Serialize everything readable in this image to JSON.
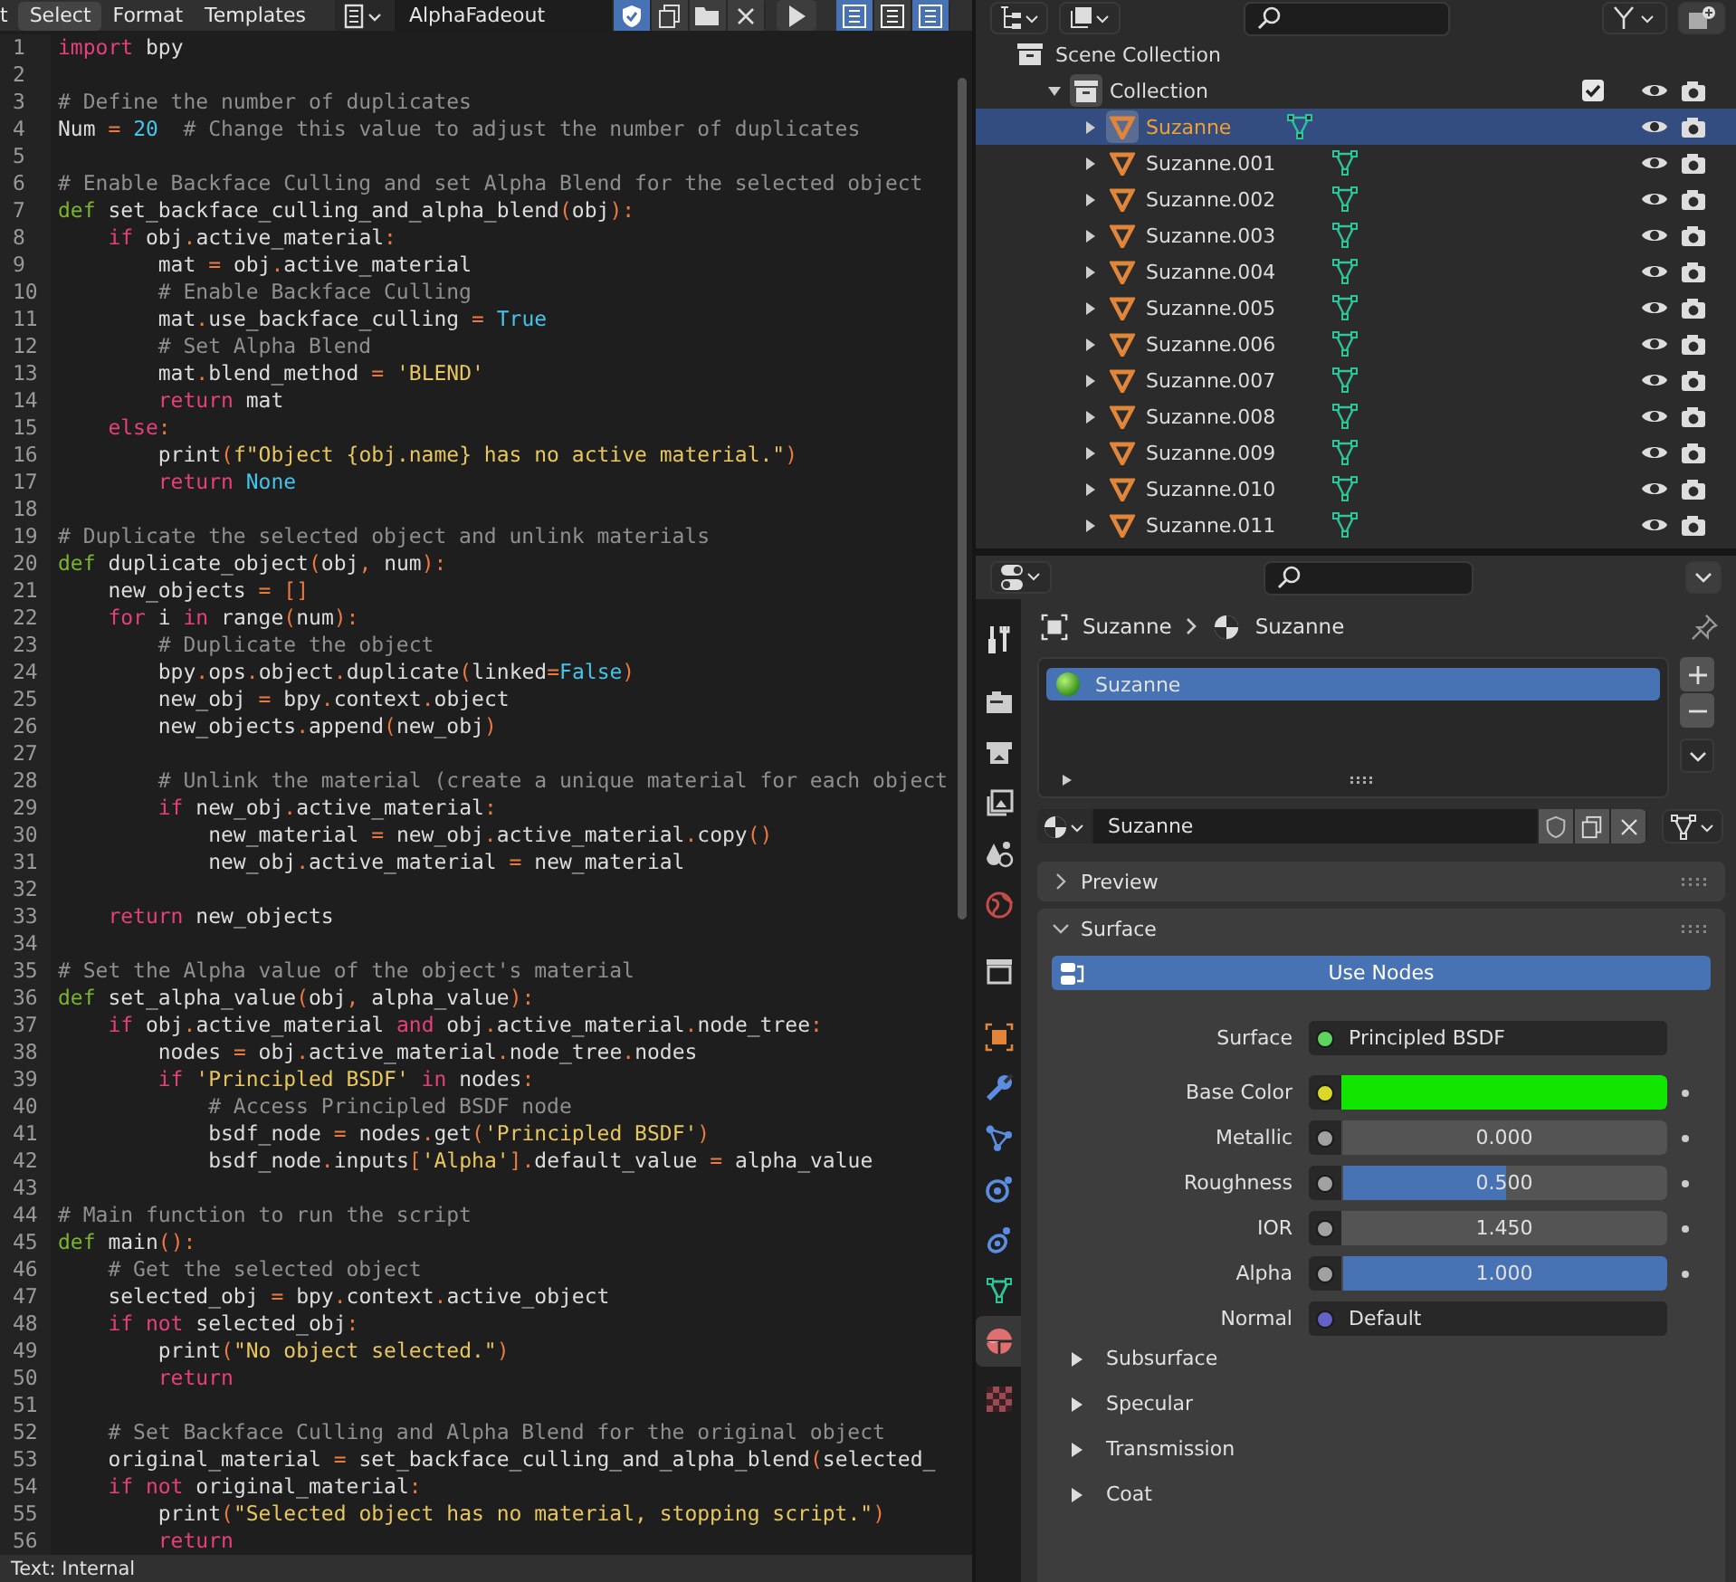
{
  "text_editor": {
    "menus": [
      {
        "label": "t",
        "selected": false
      },
      {
        "label": "Select",
        "selected": true
      },
      {
        "label": "Format",
        "selected": false
      },
      {
        "label": "Templates",
        "selected": false
      }
    ],
    "text_name": "AlphaFadeout",
    "fake_user": true,
    "toggles": [
      {
        "on": true
      },
      {
        "on": false
      },
      {
        "on": true
      }
    ],
    "lines": [
      {
        "n": "1",
        "segs": [
          {
            "kind": "keyword",
            "text": "import"
          },
          {
            "kind": "plain",
            "text": " bpy"
          }
        ]
      },
      {
        "n": "2"
      },
      {
        "n": "3",
        "segs": [
          {
            "kind": "comment",
            "text": "# Define the number of duplicates"
          }
        ]
      },
      {
        "n": "4",
        "segs": [
          {
            "kind": "plain",
            "text": "Num "
          },
          {
            "kind": "op",
            "text": "="
          },
          {
            "kind": "const",
            "text": " 20"
          },
          {
            "kind": "comment",
            "text": "  # Change this value to adjust the number of duplicates"
          }
        ]
      },
      {
        "n": "5"
      },
      {
        "n": "6",
        "segs": [
          {
            "kind": "comment",
            "text": "# Enable Backface Culling and set Alpha Blend for the selected object"
          }
        ]
      },
      {
        "n": "7",
        "segs": [
          {
            "kind": "def",
            "text": "def"
          },
          {
            "kind": "plain",
            "text": " set_backface_culling_and_alpha_blend"
          },
          {
            "kind": "op",
            "text": "("
          },
          {
            "kind": "plain",
            "text": "obj"
          },
          {
            "kind": "op",
            "text": "):"
          }
        ]
      },
      {
        "n": "8",
        "segs": [
          {
            "kind": "keyword",
            "text": "    if"
          },
          {
            "kind": "plain",
            "text": " obj"
          },
          {
            "kind": "op",
            "text": "."
          },
          {
            "kind": "plain",
            "text": "active_material"
          },
          {
            "kind": "op",
            "text": ":"
          }
        ]
      },
      {
        "n": "9",
        "segs": [
          {
            "kind": "plain",
            "text": "        mat "
          },
          {
            "kind": "op",
            "text": "="
          },
          {
            "kind": "plain",
            "text": " obj"
          },
          {
            "kind": "op",
            "text": "."
          },
          {
            "kind": "plain",
            "text": "active_material"
          }
        ]
      },
      {
        "n": "10",
        "segs": [
          {
            "kind": "comment",
            "text": "        # Enable Backface Culling"
          }
        ]
      },
      {
        "n": "11",
        "segs": [
          {
            "kind": "plain",
            "text": "        mat"
          },
          {
            "kind": "op",
            "text": "."
          },
          {
            "kind": "plain",
            "text": "use_backface_culling "
          },
          {
            "kind": "op",
            "text": "="
          },
          {
            "kind": "const",
            "text": " True"
          }
        ]
      },
      {
        "n": "12",
        "segs": [
          {
            "kind": "comment",
            "text": "        # Set Alpha Blend"
          }
        ]
      },
      {
        "n": "13",
        "segs": [
          {
            "kind": "plain",
            "text": "        mat"
          },
          {
            "kind": "op",
            "text": "."
          },
          {
            "kind": "plain",
            "text": "blend_method "
          },
          {
            "kind": "op",
            "text": "="
          },
          {
            "kind": "string",
            "text": " 'BLEND'"
          }
        ]
      },
      {
        "n": "14",
        "segs": [
          {
            "kind": "keyword",
            "text": "        return"
          },
          {
            "kind": "plain",
            "text": " mat"
          }
        ]
      },
      {
        "n": "15",
        "segs": [
          {
            "kind": "keyword",
            "text": "    else"
          },
          {
            "kind": "op",
            "text": ":"
          }
        ]
      },
      {
        "n": "16",
        "segs": [
          {
            "kind": "plain",
            "text": "        print"
          },
          {
            "kind": "op",
            "text": "("
          },
          {
            "kind": "string",
            "text": "f\"Object {obj.name} has no active material.\""
          },
          {
            "kind": "op",
            "text": ")"
          }
        ]
      },
      {
        "n": "17",
        "segs": [
          {
            "kind": "keyword",
            "text": "        return"
          },
          {
            "kind": "const",
            "text": " None"
          }
        ]
      },
      {
        "n": "18"
      },
      {
        "n": "19",
        "segs": [
          {
            "kind": "comment",
            "text": "# Duplicate the selected object and unlink materials"
          }
        ]
      },
      {
        "n": "20",
        "segs": [
          {
            "kind": "def",
            "text": "def"
          },
          {
            "kind": "plain",
            "text": " duplicate_object"
          },
          {
            "kind": "op",
            "text": "("
          },
          {
            "kind": "plain",
            "text": "obj"
          },
          {
            "kind": "op",
            "text": ","
          },
          {
            "kind": "plain",
            "text": " num"
          },
          {
            "kind": "op",
            "text": "):"
          }
        ]
      },
      {
        "n": "21",
        "segs": [
          {
            "kind": "plain",
            "text": "    new_objects "
          },
          {
            "kind": "op",
            "text": "="
          },
          {
            "kind": "op",
            "text": " []"
          }
        ]
      },
      {
        "n": "22",
        "segs": [
          {
            "kind": "keyword",
            "text": "    for"
          },
          {
            "kind": "plain",
            "text": " i "
          },
          {
            "kind": "keyword",
            "text": "in"
          },
          {
            "kind": "plain",
            "text": " range"
          },
          {
            "kind": "op",
            "text": "("
          },
          {
            "kind": "plain",
            "text": "num"
          },
          {
            "kind": "op",
            "text": "):"
          }
        ]
      },
      {
        "n": "23",
        "segs": [
          {
            "kind": "comment",
            "text": "        # Duplicate the object"
          }
        ]
      },
      {
        "n": "24",
        "segs": [
          {
            "kind": "plain",
            "text": "        bpy"
          },
          {
            "kind": "op",
            "text": "."
          },
          {
            "kind": "plain",
            "text": "ops"
          },
          {
            "kind": "op",
            "text": "."
          },
          {
            "kind": "plain",
            "text": "object"
          },
          {
            "kind": "op",
            "text": "."
          },
          {
            "kind": "plain",
            "text": "duplicate"
          },
          {
            "kind": "op",
            "text": "("
          },
          {
            "kind": "plain",
            "text": "linked"
          },
          {
            "kind": "op",
            "text": "="
          },
          {
            "kind": "const",
            "text": "False"
          },
          {
            "kind": "op",
            "text": ")"
          }
        ]
      },
      {
        "n": "25",
        "segs": [
          {
            "kind": "plain",
            "text": "        new_obj "
          },
          {
            "kind": "op",
            "text": "="
          },
          {
            "kind": "plain",
            "text": " bpy"
          },
          {
            "kind": "op",
            "text": "."
          },
          {
            "kind": "plain",
            "text": "context"
          },
          {
            "kind": "op",
            "text": "."
          },
          {
            "kind": "plain",
            "text": "object"
          }
        ]
      },
      {
        "n": "26",
        "segs": [
          {
            "kind": "plain",
            "text": "        new_objects"
          },
          {
            "kind": "op",
            "text": "."
          },
          {
            "kind": "plain",
            "text": "append"
          },
          {
            "kind": "op",
            "text": "("
          },
          {
            "kind": "plain",
            "text": "new_obj"
          },
          {
            "kind": "op",
            "text": ")"
          }
        ]
      },
      {
        "n": "27"
      },
      {
        "n": "28",
        "segs": [
          {
            "kind": "comment",
            "text": "        # Unlink the material (create a unique material for each object"
          }
        ]
      },
      {
        "n": "29",
        "segs": [
          {
            "kind": "keyword",
            "text": "        if"
          },
          {
            "kind": "plain",
            "text": " new_obj"
          },
          {
            "kind": "op",
            "text": "."
          },
          {
            "kind": "plain",
            "text": "active_material"
          },
          {
            "kind": "op",
            "text": ":"
          }
        ]
      },
      {
        "n": "30",
        "segs": [
          {
            "kind": "plain",
            "text": "            new_material "
          },
          {
            "kind": "op",
            "text": "="
          },
          {
            "kind": "plain",
            "text": " new_obj"
          },
          {
            "kind": "op",
            "text": "."
          },
          {
            "kind": "plain",
            "text": "active_material"
          },
          {
            "kind": "op",
            "text": "."
          },
          {
            "kind": "plain",
            "text": "copy"
          },
          {
            "kind": "op",
            "text": "()"
          }
        ]
      },
      {
        "n": "31",
        "segs": [
          {
            "kind": "plain",
            "text": "            new_obj"
          },
          {
            "kind": "op",
            "text": "."
          },
          {
            "kind": "plain",
            "text": "active_material "
          },
          {
            "kind": "op",
            "text": "="
          },
          {
            "kind": "plain",
            "text": " new_material"
          }
        ]
      },
      {
        "n": "32"
      },
      {
        "n": "33",
        "segs": [
          {
            "kind": "keyword",
            "text": "    return"
          },
          {
            "kind": "plain",
            "text": " new_objects"
          }
        ]
      },
      {
        "n": "34"
      },
      {
        "n": "35",
        "segs": [
          {
            "kind": "comment",
            "text": "# Set the Alpha value of the object's material"
          }
        ]
      },
      {
        "n": "36",
        "segs": [
          {
            "kind": "def",
            "text": "def"
          },
          {
            "kind": "plain",
            "text": " set_alpha_value"
          },
          {
            "kind": "op",
            "text": "("
          },
          {
            "kind": "plain",
            "text": "obj"
          },
          {
            "kind": "op",
            "text": ","
          },
          {
            "kind": "plain",
            "text": " alpha_value"
          },
          {
            "kind": "op",
            "text": "):"
          }
        ]
      },
      {
        "n": "37",
        "segs": [
          {
            "kind": "keyword",
            "text": "    if"
          },
          {
            "kind": "plain",
            "text": " obj"
          },
          {
            "kind": "op",
            "text": "."
          },
          {
            "kind": "plain",
            "text": "active_material "
          },
          {
            "kind": "keyword",
            "text": "and"
          },
          {
            "kind": "plain",
            "text": " obj"
          },
          {
            "kind": "op",
            "text": "."
          },
          {
            "kind": "plain",
            "text": "active_material"
          },
          {
            "kind": "op",
            "text": "."
          },
          {
            "kind": "plain",
            "text": "node_tree"
          },
          {
            "kind": "op",
            "text": ":"
          }
        ]
      },
      {
        "n": "38",
        "segs": [
          {
            "kind": "plain",
            "text": "        nodes "
          },
          {
            "kind": "op",
            "text": "="
          },
          {
            "kind": "plain",
            "text": " obj"
          },
          {
            "kind": "op",
            "text": "."
          },
          {
            "kind": "plain",
            "text": "active_material"
          },
          {
            "kind": "op",
            "text": "."
          },
          {
            "kind": "plain",
            "text": "node_tree"
          },
          {
            "kind": "op",
            "text": "."
          },
          {
            "kind": "plain",
            "text": "nodes"
          }
        ]
      },
      {
        "n": "39",
        "segs": [
          {
            "kind": "keyword",
            "text": "        if"
          },
          {
            "kind": "string",
            "text": " 'Principled BSDF'"
          },
          {
            "kind": "keyword",
            "text": " in"
          },
          {
            "kind": "plain",
            "text": " nodes"
          },
          {
            "kind": "op",
            "text": ":"
          }
        ]
      },
      {
        "n": "40",
        "segs": [
          {
            "kind": "comment",
            "text": "            # Access Principled BSDF node"
          }
        ]
      },
      {
        "n": "41",
        "segs": [
          {
            "kind": "plain",
            "text": "            bsdf_node "
          },
          {
            "kind": "op",
            "text": "="
          },
          {
            "kind": "plain",
            "text": " nodes"
          },
          {
            "kind": "op",
            "text": "."
          },
          {
            "kind": "plain",
            "text": "get"
          },
          {
            "kind": "op",
            "text": "("
          },
          {
            "kind": "string",
            "text": "'Principled BSDF'"
          },
          {
            "kind": "op",
            "text": ")"
          }
        ]
      },
      {
        "n": "42",
        "segs": [
          {
            "kind": "plain",
            "text": "            bsdf_node"
          },
          {
            "kind": "op",
            "text": "."
          },
          {
            "kind": "plain",
            "text": "inputs"
          },
          {
            "kind": "op",
            "text": "["
          },
          {
            "kind": "string",
            "text": "'Alpha'"
          },
          {
            "kind": "op",
            "text": "]."
          },
          {
            "kind": "plain",
            "text": "default_value "
          },
          {
            "kind": "op",
            "text": "="
          },
          {
            "kind": "plain",
            "text": " alpha_value"
          }
        ]
      },
      {
        "n": "43"
      },
      {
        "n": "44",
        "segs": [
          {
            "kind": "comment",
            "text": "# Main function to run the script"
          }
        ]
      },
      {
        "n": "45",
        "segs": [
          {
            "kind": "def",
            "text": "def"
          },
          {
            "kind": "plain",
            "text": " main"
          },
          {
            "kind": "op",
            "text": "():"
          }
        ]
      },
      {
        "n": "46",
        "segs": [
          {
            "kind": "comment",
            "text": "    # Get the selected object"
          }
        ]
      },
      {
        "n": "47",
        "segs": [
          {
            "kind": "plain",
            "text": "    selected_obj "
          },
          {
            "kind": "op",
            "text": "="
          },
          {
            "kind": "plain",
            "text": " bpy"
          },
          {
            "kind": "op",
            "text": "."
          },
          {
            "kind": "plain",
            "text": "context"
          },
          {
            "kind": "op",
            "text": "."
          },
          {
            "kind": "plain",
            "text": "active_object"
          }
        ]
      },
      {
        "n": "48",
        "segs": [
          {
            "kind": "keyword",
            "text": "    if not"
          },
          {
            "kind": "plain",
            "text": " selected_obj"
          },
          {
            "kind": "op",
            "text": ":"
          }
        ]
      },
      {
        "n": "49",
        "segs": [
          {
            "kind": "plain",
            "text": "        print"
          },
          {
            "kind": "op",
            "text": "("
          },
          {
            "kind": "string",
            "text": "\"No object selected.\""
          },
          {
            "kind": "op",
            "text": ")"
          }
        ]
      },
      {
        "n": "50",
        "segs": [
          {
            "kind": "keyword",
            "text": "        return"
          }
        ]
      },
      {
        "n": "51"
      },
      {
        "n": "52",
        "segs": [
          {
            "kind": "comment",
            "text": "    # Set Backface Culling and Alpha Blend for the original object"
          }
        ]
      },
      {
        "n": "53",
        "segs": [
          {
            "kind": "plain",
            "text": "    original_material "
          },
          {
            "kind": "op",
            "text": "="
          },
          {
            "kind": "plain",
            "text": " set_backface_culling_and_alpha_blend"
          },
          {
            "kind": "op",
            "text": "("
          },
          {
            "kind": "plain",
            "text": "selected_"
          }
        ]
      },
      {
        "n": "54",
        "segs": [
          {
            "kind": "keyword",
            "text": "    if not"
          },
          {
            "kind": "plain",
            "text": " original_material"
          },
          {
            "kind": "op",
            "text": ":"
          }
        ]
      },
      {
        "n": "55",
        "segs": [
          {
            "kind": "plain",
            "text": "        print"
          },
          {
            "kind": "op",
            "text": "("
          },
          {
            "kind": "string",
            "text": "\"Selected object has no material, stopping script.\""
          },
          {
            "kind": "op",
            "text": ")"
          }
        ]
      },
      {
        "n": "56",
        "segs": [
          {
            "kind": "keyword",
            "text": "        return"
          }
        ]
      }
    ],
    "status": "Text: Internal"
  },
  "outliner": {
    "tree": [
      {
        "kind": "scene",
        "label": "Scene Collection",
        "children": [
          {
            "kind": "collection",
            "label": "Collection",
            "expanded": true,
            "checked": true,
            "children": [
              {
                "kind": "object",
                "label": "Suzanne",
                "selected": true
              },
              {
                "kind": "object",
                "label": "Suzanne.001",
                "selected": false
              },
              {
                "kind": "object",
                "label": "Suzanne.002",
                "selected": false
              },
              {
                "kind": "object",
                "label": "Suzanne.003",
                "selected": false
              },
              {
                "kind": "object",
                "label": "Suzanne.004",
                "selected": false
              },
              {
                "kind": "object",
                "label": "Suzanne.005",
                "selected": false
              },
              {
                "kind": "object",
                "label": "Suzanne.006",
                "selected": false
              },
              {
                "kind": "object",
                "label": "Suzanne.007",
                "selected": false
              },
              {
                "kind": "object",
                "label": "Suzanne.008",
                "selected": false
              },
              {
                "kind": "object",
                "label": "Suzanne.009",
                "selected": false
              },
              {
                "kind": "object",
                "label": "Suzanne.010",
                "selected": false
              },
              {
                "kind": "object",
                "label": "Suzanne.011",
                "selected": false
              }
            ]
          }
        ]
      }
    ]
  },
  "properties": {
    "tabs": [
      {
        "selected": false
      },
      {
        "selected": false
      },
      {
        "selected": false
      },
      {
        "selected": false
      },
      {
        "selected": false
      },
      {
        "selected": false
      },
      {
        "selected": false
      },
      {
        "selected": false
      },
      {
        "selected": false
      },
      {
        "selected": false
      },
      {
        "selected": false
      },
      {
        "selected": false
      },
      {
        "selected": false
      },
      {
        "selected": true
      },
      {
        "selected": false
      }
    ],
    "breadcrumb": [
      "Suzanne",
      "Suzanne"
    ],
    "slots": [
      {
        "label": "Suzanne",
        "selected": true
      }
    ],
    "material_name": "Suzanne",
    "panels": [
      {
        "label": "Preview",
        "expanded": false
      },
      {
        "label": "Surface",
        "expanded": true
      }
    ],
    "use_nodes": "Use Nodes",
    "inputs": [
      {
        "kind": "link",
        "label": "Surface",
        "value": "Principled BSDF",
        "color": "#5fd35f"
      },
      {
        "kind": "swatch",
        "label": "Base Color",
        "swatch": {
          "color": "#10e600"
        },
        "color": "#d9d92a"
      },
      {
        "kind": "slider",
        "label": "Metallic",
        "value": "0.000",
        "level": 0,
        "color": "#a1a1a1"
      },
      {
        "kind": "slider",
        "label": "Roughness",
        "value": "0.500",
        "level": 0.5,
        "color": "#a1a1a1"
      },
      {
        "kind": "number",
        "label": "IOR",
        "value": "1.450",
        "color": "#a1a1a1"
      },
      {
        "kind": "slider",
        "label": "Alpha",
        "value": "1.000",
        "level": 1,
        "color": "#a1a1a1"
      },
      {
        "kind": "link",
        "label": "Normal",
        "value": "Default",
        "color": "#6363c7"
      }
    ],
    "subpanels": [
      {
        "label": "Subsurface",
        "expanded": false
      },
      {
        "label": "Specular",
        "expanded": false
      },
      {
        "label": "Transmission",
        "expanded": false
      },
      {
        "label": "Coat",
        "expanded": false
      }
    ]
  }
}
